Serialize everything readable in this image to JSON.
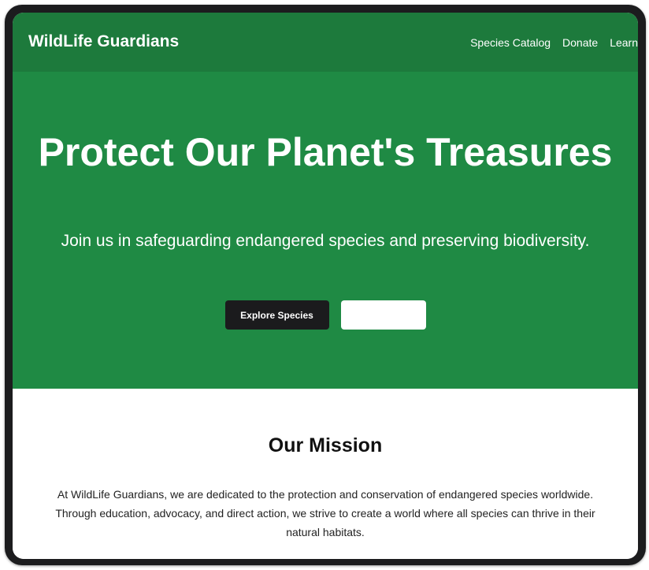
{
  "site": {
    "brand": "WildLife Guardians"
  },
  "nav": {
    "items": [
      {
        "label": "Species Catalog"
      },
      {
        "label": "Donate"
      },
      {
        "label": "Learn"
      }
    ]
  },
  "hero": {
    "title": "Protect Our Planet's Treasures",
    "subtitle": "Join us in safeguarding endangered species and preserving biodiversity.",
    "primary_button": "Explore Species",
    "secondary_button": ""
  },
  "mission": {
    "title": "Our Mission",
    "text": "At WildLife Guardians, we are dedicated to the protection and conservation of endangered species worldwide. Through education, advocacy, and direct action, we strive to create a world where all species can thrive in their natural habitats."
  },
  "colors": {
    "nav_bg": "#1d7a3c",
    "hero_bg": "#1f8a44",
    "dark_button": "#1b1b1d"
  }
}
